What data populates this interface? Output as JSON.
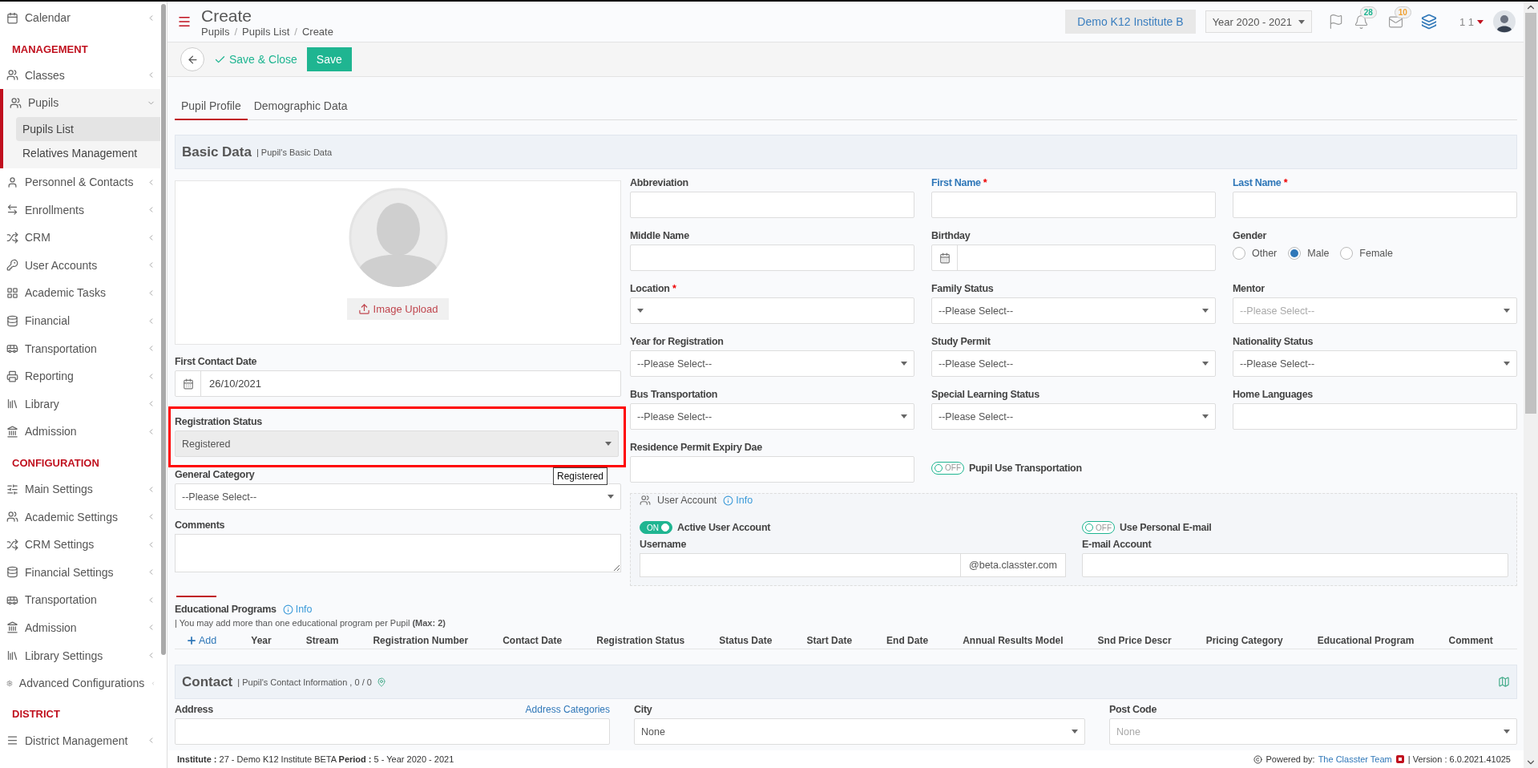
{
  "sidebar": {
    "items": [
      {
        "kind": "item",
        "label": "Calendar",
        "selected": false,
        "expanded": false
      },
      {
        "kind": "heading",
        "label": "MANAGEMENT"
      },
      {
        "kind": "item",
        "label": "Classes",
        "selected": false,
        "expanded": false
      },
      {
        "kind": "item",
        "label": "Pupils",
        "selected": false,
        "expanded": true,
        "children": [
          {
            "label": "Pupils List",
            "selected": true
          },
          {
            "label": "Relatives Management",
            "selected": false
          }
        ]
      },
      {
        "kind": "item",
        "label": "Personnel & Contacts",
        "selected": false,
        "expanded": false
      },
      {
        "kind": "item",
        "label": "Enrollments",
        "selected": false,
        "expanded": false
      },
      {
        "kind": "item",
        "label": "CRM",
        "selected": false,
        "expanded": false
      },
      {
        "kind": "item",
        "label": "User Accounts",
        "selected": false,
        "expanded": false
      },
      {
        "kind": "item",
        "label": "Academic Tasks",
        "selected": false,
        "expanded": false
      },
      {
        "kind": "item",
        "label": "Financial",
        "selected": false,
        "expanded": false
      },
      {
        "kind": "item",
        "label": "Transportation",
        "selected": false,
        "expanded": false
      },
      {
        "kind": "item",
        "label": "Reporting",
        "selected": false,
        "expanded": false
      },
      {
        "kind": "item",
        "label": "Library",
        "selected": false,
        "expanded": false
      },
      {
        "kind": "item",
        "label": "Admission",
        "selected": false,
        "expanded": false
      },
      {
        "kind": "heading",
        "label": "CONFIGURATION"
      },
      {
        "kind": "item",
        "label": "Main Settings",
        "selected": false,
        "expanded": false
      },
      {
        "kind": "item",
        "label": "Academic Settings",
        "selected": false,
        "expanded": false
      },
      {
        "kind": "item",
        "label": "CRM Settings",
        "selected": false,
        "expanded": false
      },
      {
        "kind": "item",
        "label": "Financial Settings",
        "selected": false,
        "expanded": false
      },
      {
        "kind": "item",
        "label": "Transportation",
        "selected": false,
        "expanded": false
      },
      {
        "kind": "item",
        "label": "Admission",
        "selected": false,
        "expanded": false
      },
      {
        "kind": "item",
        "label": "Library Settings",
        "selected": false,
        "expanded": false
      },
      {
        "kind": "item",
        "label": "Advanced Configurations",
        "selected": false,
        "expanded": false
      },
      {
        "kind": "heading",
        "label": "DISTRICT"
      },
      {
        "kind": "item",
        "label": "District Management",
        "selected": false,
        "expanded": false
      }
    ]
  },
  "header": {
    "title": "Create",
    "breadcrumb": {
      "separator": "/",
      "items": [
        "Pupils",
        "Pupils List",
        "Create"
      ]
    },
    "institute": "Demo K12 Institute B",
    "year": "Year 2020 - 2021",
    "notifications_count": "28",
    "messages_count": "10",
    "user_label": "1 1"
  },
  "toolbar": {
    "save_close": "Save & Close",
    "save": "Save"
  },
  "tabs": [
    {
      "label": "Pupil Profile",
      "selected": true
    },
    {
      "label": "Demographic Data",
      "selected": false
    }
  ],
  "basic_data": {
    "title": "Basic Data",
    "subtitle": "| Pupil's Basic Data",
    "required_mark": "*",
    "photo": {
      "upload_label": "Image Upload"
    },
    "left_fields": [
      {
        "kind": "date",
        "label": "First Contact Date",
        "value": "26/10/2021",
        "outlined": false
      },
      {
        "kind": "select",
        "label": "Registration Status",
        "value": "Registered",
        "disabled": true,
        "outlined": true,
        "tooltip": "Registered"
      },
      {
        "kind": "select",
        "label": "General Category",
        "value": "--Please Select--",
        "disabled": false,
        "outlined": false
      },
      {
        "kind": "textarea",
        "label": "Comments",
        "outlined": false
      }
    ],
    "fields": [
      {
        "kind": "text",
        "label": "Abbreviation",
        "required": false,
        "emphasized": false
      },
      {
        "kind": "text",
        "label": "First Name",
        "required": true,
        "emphasized": true
      },
      {
        "kind": "text",
        "label": "Last Name",
        "required": true,
        "emphasized": true
      },
      {
        "kind": "text",
        "label": "Middle Name",
        "required": false,
        "emphasized": false
      },
      {
        "kind": "date",
        "label": "Birthday",
        "required": false,
        "emphasized": false
      },
      {
        "kind": "radio",
        "label": "Gender",
        "required": false,
        "emphasized": false,
        "options": [
          {
            "label": "Other",
            "selected": false
          },
          {
            "label": "Male",
            "selected": true
          },
          {
            "label": "Female",
            "selected": false
          }
        ]
      },
      {
        "kind": "select",
        "label": "Location",
        "required": true,
        "emphasized": false,
        "disabled": false
      },
      {
        "kind": "select",
        "label": "Family Status",
        "required": false,
        "emphasized": false,
        "disabled": false,
        "value": "--Please Select--"
      },
      {
        "kind": "select",
        "label": "Mentor",
        "required": false,
        "emphasized": false,
        "disabled": false,
        "placeholder": "--Please Select--"
      },
      {
        "kind": "select",
        "label": "Year for Registration",
        "required": false,
        "emphasized": false,
        "disabled": false,
        "value": "--Please Select--"
      },
      {
        "kind": "select",
        "label": "Study Permit",
        "required": false,
        "emphasized": false,
        "disabled": false,
        "value": "--Please Select--"
      },
      {
        "kind": "select",
        "label": "Nationality Status",
        "required": false,
        "emphasized": false,
        "disabled": false,
        "value": "--Please Select--"
      },
      {
        "kind": "select",
        "label": "Bus Transportation",
        "required": false,
        "emphasized": false,
        "disabled": false,
        "value": "--Please Select--"
      },
      {
        "kind": "select",
        "label": "Special Learning Status",
        "required": false,
        "emphasized": false,
        "disabled": false,
        "value": "--Please Select--"
      },
      {
        "kind": "text",
        "label": "Home Languages",
        "required": false,
        "emphasized": false
      },
      {
        "kind": "text",
        "label": "Residence Permit Expiry Dae",
        "required": false,
        "emphasized": false
      },
      {
        "kind": "toggle",
        "label": "Pupil Use Transportation",
        "on": false,
        "switch_text": "OFF"
      }
    ],
    "user_account": {
      "title": "User Account",
      "info": "Info",
      "active": {
        "label": "Active User Account",
        "on": true,
        "switch_text": "ON"
      },
      "personal_email": {
        "label": "Use Personal E-mail",
        "on": false,
        "switch_text": "OFF"
      },
      "username": {
        "label": "Username",
        "suffix": "@beta.classter.com"
      },
      "email": {
        "label": "E-mail Account"
      }
    }
  },
  "educational_programs": {
    "title": "Educational Programs",
    "info": "Info",
    "note": "| You may add more than one educational program per Pupil **(Max: 2)**",
    "add": "Add",
    "columns": [
      "Year",
      "Stream",
      "Registration Number",
      "Contact Date",
      "Registration Status",
      "Status Date",
      "Start Date",
      "End Date",
      "Annual Results Model",
      "Snd Price Descr",
      "Pricing Category",
      "Educational Program",
      "Comment"
    ]
  },
  "contact": {
    "title": "Contact",
    "subtitle": "| Pupil's Contact Information , 0 / 0",
    "address": {
      "label": "Address",
      "link": "Address Categories"
    },
    "city": {
      "label": "City",
      "value": "None"
    },
    "post_code": {
      "label": "Post Code",
      "placeholder": "None"
    }
  },
  "footer": {
    "info": "**Institute :** 27 - Demo K12 Institute BETA **Period :** 5 - Year 2020 - 2021",
    "powered": "Powered by:",
    "team": "The Classter Team",
    "version": "| Version : 6.0.2021.41025"
  }
}
